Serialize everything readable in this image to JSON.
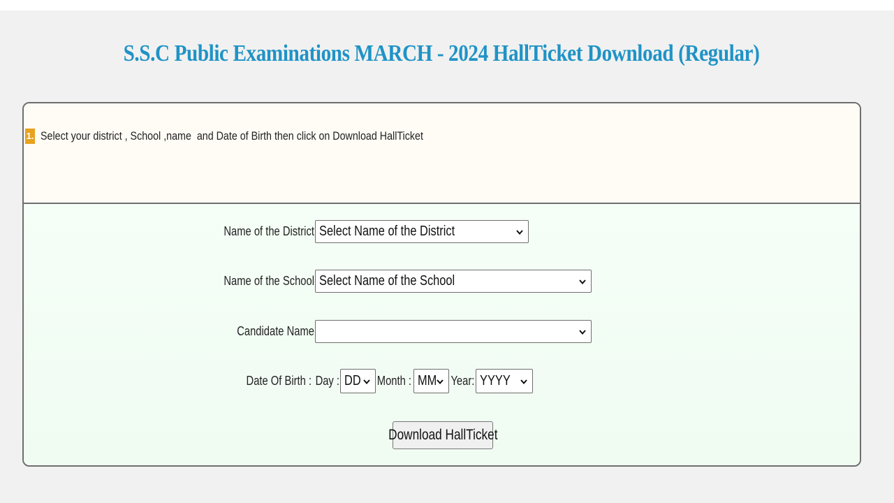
{
  "page": {
    "title": "S.S.C Public Examinations MARCH - 2024 HallTicket Download (Regular)",
    "title_color": "#1f93c6"
  },
  "instruction": {
    "step_number": "1.",
    "text": "Select your district , School ,name  and Date of Birth then click on Download HallTicket",
    "badge_color": "#e8a21f"
  },
  "form": {
    "district": {
      "label": "Name of the District:",
      "selected": "Select Name of the District"
    },
    "school": {
      "label": "Name of the School:",
      "selected": "Select Name of the School"
    },
    "candidate": {
      "label": "Candidate Name:",
      "selected": ""
    },
    "dob": {
      "label": "Date Of Birth :",
      "day_label": "Day :",
      "day_selected": "DD",
      "month_label": "Month :",
      "month_selected": "MM",
      "year_label": "Year:",
      "year_selected": "YYYY"
    },
    "download_button": "Download HallTicket"
  },
  "icons": {
    "dropdown": "chevron-down-icon"
  }
}
